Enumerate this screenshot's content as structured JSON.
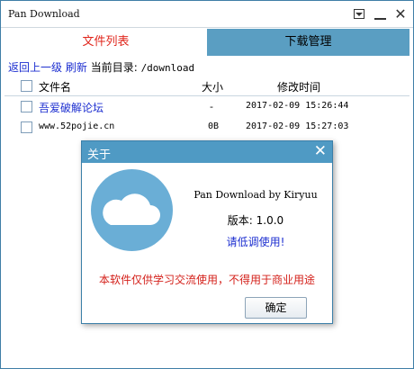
{
  "window": {
    "title": "Pan Download",
    "close_glyph": "✕"
  },
  "tabs": [
    {
      "label": "文件列表",
      "active": true
    },
    {
      "label": "下载管理",
      "active": false
    }
  ],
  "pathbar": {
    "back_label": "返回上一级",
    "refresh_label": "刷新",
    "current_dir_label": "当前目录:",
    "current_dir": "/download"
  },
  "columns": {
    "name": "文件名",
    "size": "大小",
    "modified": "修改时间"
  },
  "files": [
    {
      "name": "吾爱破解论坛",
      "size": "-",
      "modified": "2017-02-09 15:26:44",
      "type": "folder"
    },
    {
      "name": "www.52pojie.cn",
      "size": "0B",
      "modified": "2017-02-09 15:27:03",
      "type": "file"
    }
  ],
  "about": {
    "title": "关于",
    "close_glyph": "✕",
    "app_line": "Pan Download by Kiryuu",
    "version_line": "版本: 1.0.0",
    "hint": "请低调使用!",
    "warning": "本软件仅供学习交流使用，不得用于商业用途",
    "ok_label": "确定"
  },
  "colors": {
    "accent": "#4f9ac4",
    "tab_inactive": "#5a9ec2",
    "link": "#1d2fd0",
    "warning": "#d4201a",
    "logo_circle": "#6aaed6"
  },
  "icons": [
    "dropdown-menu-icon",
    "minimize-icon",
    "close-icon",
    "cloud-logo-icon"
  ]
}
